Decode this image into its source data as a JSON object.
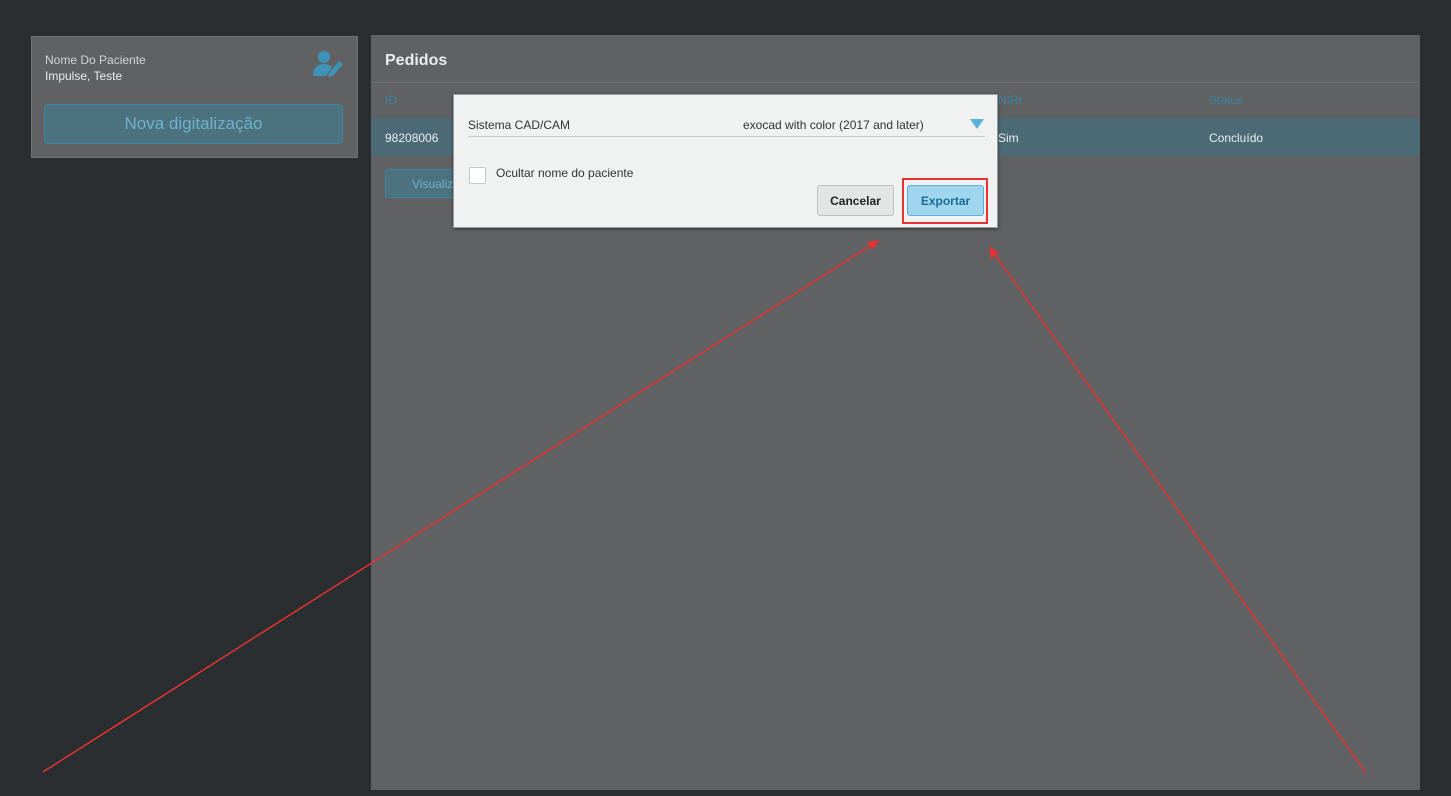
{
  "patient": {
    "label": "Nome Do Paciente",
    "name": "Impulse, Teste",
    "new_scan_label": "Nova digitalização",
    "edit_icon": "user-edit-icon"
  },
  "orders": {
    "title": "Pedidos",
    "columns": {
      "id": "ID",
      "niri": "NIRI",
      "status": "Status"
    },
    "rows": [
      {
        "id": "98208006",
        "niri": "Sim",
        "status": "Concluído"
      }
    ],
    "view_button_label": "Visualizar"
  },
  "dialog": {
    "cad_label": "Sistema CAD/CAM",
    "cad_value": "exocad with color (2017 and later)",
    "hide_name_label": "Ocultar nome do paciente",
    "hide_name_checked": false,
    "cancel_label": "Cancelar",
    "export_label": "Exportar"
  },
  "colors": {
    "accent": "#3d86a3",
    "highlight": "#e53232",
    "annotation_arrow": "#e53232"
  }
}
